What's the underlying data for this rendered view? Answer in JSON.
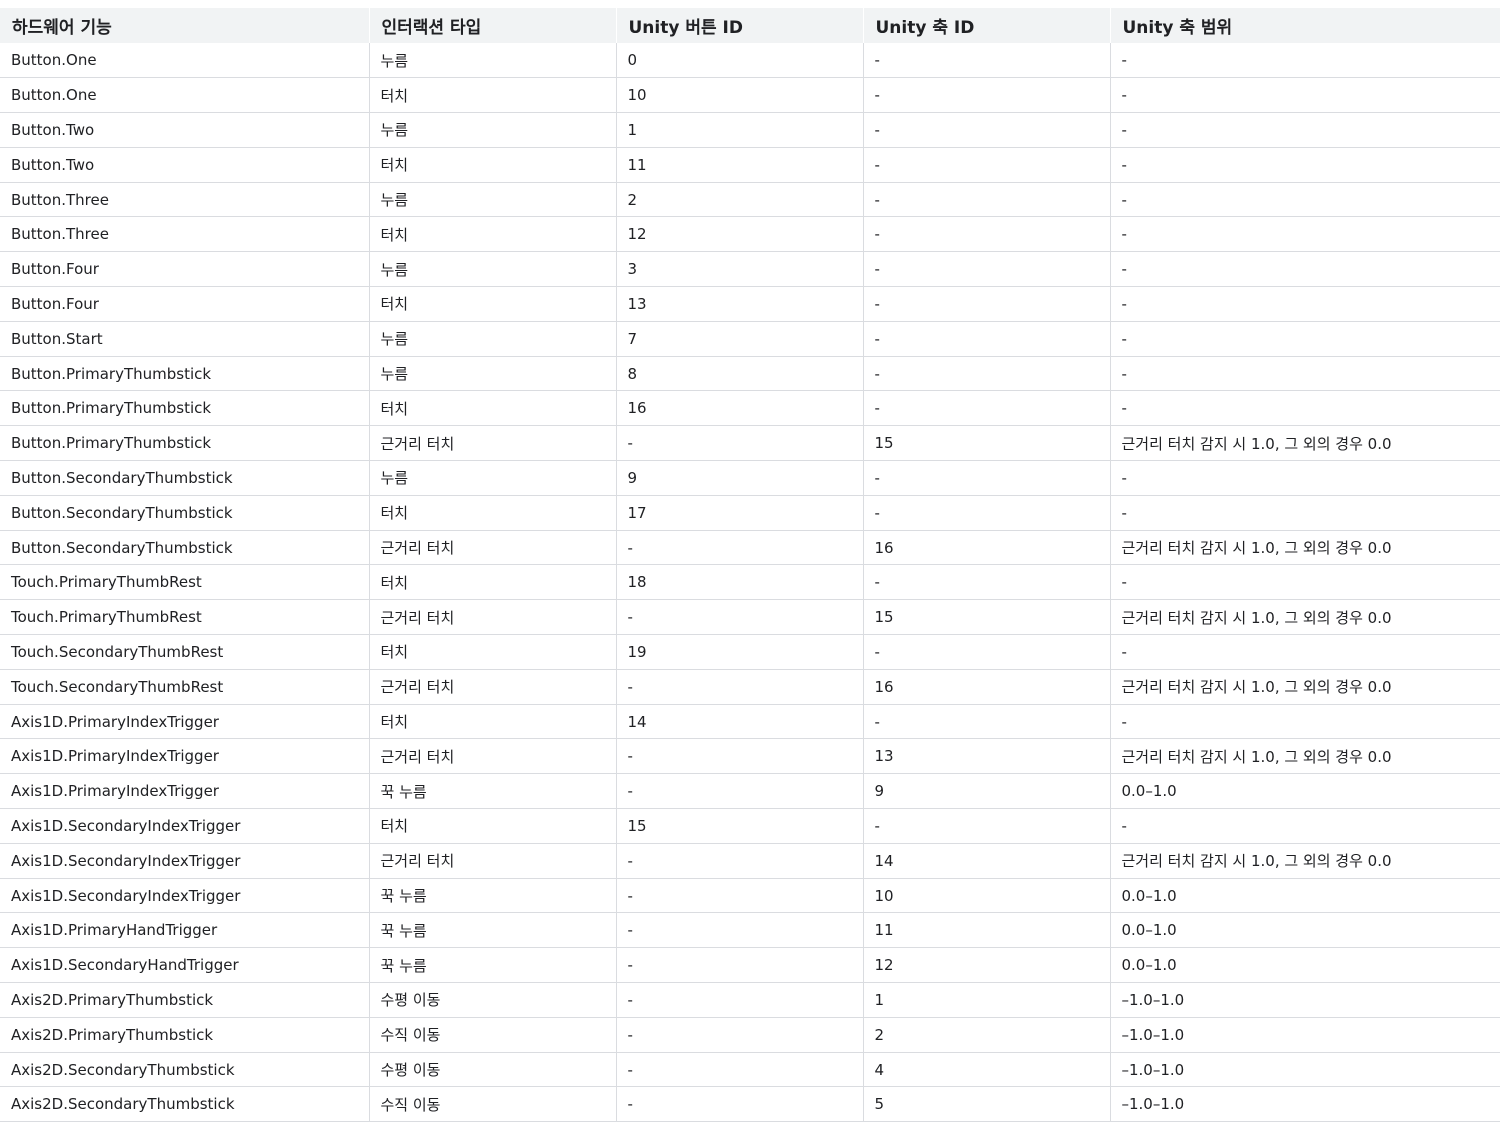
{
  "table": {
    "headers": [
      "하드웨어 기능",
      "인터랙션 타입",
      "Unity 버튼 ID",
      "Unity 축 ID",
      "Unity 축 범위"
    ],
    "rows": [
      [
        "Button.One",
        "누름",
        "0",
        "-",
        "-"
      ],
      [
        "Button.One",
        "터치",
        "10",
        "-",
        "-"
      ],
      [
        "Button.Two",
        "누름",
        "1",
        "-",
        "-"
      ],
      [
        "Button.Two",
        "터치",
        "11",
        "-",
        "-"
      ],
      [
        "Button.Three",
        "누름",
        "2",
        "-",
        "-"
      ],
      [
        "Button.Three",
        "터치",
        "12",
        "-",
        "-"
      ],
      [
        "Button.Four",
        "누름",
        "3",
        "-",
        "-"
      ],
      [
        "Button.Four",
        "터치",
        "13",
        "-",
        "-"
      ],
      [
        "Button.Start",
        "누름",
        "7",
        "-",
        "-"
      ],
      [
        "Button.PrimaryThumbstick",
        "누름",
        "8",
        "-",
        "-"
      ],
      [
        "Button.PrimaryThumbstick",
        "터치",
        "16",
        "-",
        "-"
      ],
      [
        "Button.PrimaryThumbstick",
        "근거리 터치",
        "-",
        "15",
        "근거리 터치 감지 시 1.0, 그 외의 경우 0.0"
      ],
      [
        "Button.SecondaryThumbstick",
        "누름",
        "9",
        "-",
        "-"
      ],
      [
        "Button.SecondaryThumbstick",
        "터치",
        "17",
        "-",
        "-"
      ],
      [
        "Button.SecondaryThumbstick",
        "근거리 터치",
        "-",
        "16",
        "근거리 터치 감지 시 1.0, 그 외의 경우 0.0"
      ],
      [
        "Touch.PrimaryThumbRest",
        "터치",
        "18",
        "-",
        "-"
      ],
      [
        "Touch.PrimaryThumbRest",
        "근거리 터치",
        "-",
        "15",
        "근거리 터치 감지 시 1.0, 그 외의 경우 0.0"
      ],
      [
        "Touch.SecondaryThumbRest",
        "터치",
        "19",
        "-",
        "-"
      ],
      [
        "Touch.SecondaryThumbRest",
        "근거리 터치",
        "-",
        "16",
        "근거리 터치 감지 시 1.0, 그 외의 경우 0.0"
      ],
      [
        "Axis1D.PrimaryIndexTrigger",
        "터치",
        "14",
        "-",
        "-"
      ],
      [
        "Axis1D.PrimaryIndexTrigger",
        "근거리 터치",
        "-",
        "13",
        "근거리 터치 감지 시 1.0, 그 외의 경우 0.0"
      ],
      [
        "Axis1D.PrimaryIndexTrigger",
        "꾹 누름",
        "-",
        "9",
        "0.0–1.0"
      ],
      [
        "Axis1D.SecondaryIndexTrigger",
        "터치",
        "15",
        "-",
        "-"
      ],
      [
        "Axis1D.SecondaryIndexTrigger",
        "근거리 터치",
        "-",
        "14",
        "근거리 터치 감지 시 1.0, 그 외의 경우 0.0"
      ],
      [
        "Axis1D.SecondaryIndexTrigger",
        "꾹 누름",
        "-",
        "10",
        "0.0–1.0"
      ],
      [
        "Axis1D.PrimaryHandTrigger",
        "꾹 누름",
        "-",
        "11",
        "0.0–1.0"
      ],
      [
        "Axis1D.SecondaryHandTrigger",
        "꾹 누름",
        "-",
        "12",
        "0.0–1.0"
      ],
      [
        "Axis2D.PrimaryThumbstick",
        "수평 이동",
        "-",
        "1",
        "–1.0–1.0"
      ],
      [
        "Axis2D.PrimaryThumbstick",
        "수직 이동",
        "-",
        "2",
        "–1.0–1.0"
      ],
      [
        "Axis2D.SecondaryThumbstick",
        "수평 이동",
        "-",
        "4",
        "–1.0–1.0"
      ],
      [
        "Axis2D.SecondaryThumbstick",
        "수직 이동",
        "-",
        "5",
        "–1.0–1.0"
      ]
    ]
  }
}
